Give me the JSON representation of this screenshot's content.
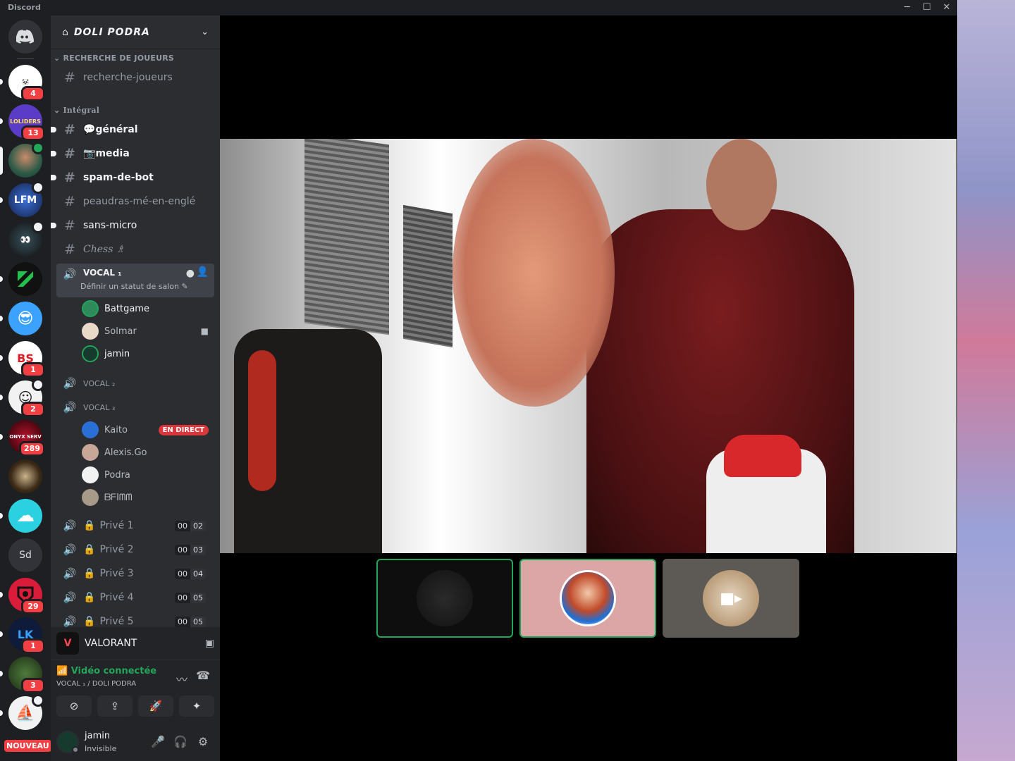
{
  "window": {
    "app_name": "Discord",
    "controls": [
      "minimize",
      "maximize",
      "close"
    ]
  },
  "servers": [
    {
      "name": "discord-home",
      "badge": ""
    },
    {
      "name": "WEGOPANDA",
      "badge": "4"
    },
    {
      "name": "LOLIDERS",
      "badge": "13"
    },
    {
      "name": "avatar-server",
      "badge": ""
    },
    {
      "name": "LFM",
      "badge": ""
    },
    {
      "name": "server-5",
      "badge": ""
    },
    {
      "name": "server-6",
      "badge": ""
    },
    {
      "name": "server-7",
      "badge": ""
    },
    {
      "name": "BS",
      "badge": "1"
    },
    {
      "name": "server-9",
      "badge": "2"
    },
    {
      "name": "ONYX SERV",
      "badge": "289"
    },
    {
      "name": "server-11",
      "badge": ""
    },
    {
      "name": "cloud-server",
      "badge": ""
    },
    {
      "name": "Sd",
      "badge": ""
    },
    {
      "name": "server-14",
      "badge": "29"
    },
    {
      "name": "LK COMMU",
      "badge": "1"
    },
    {
      "name": "server-16",
      "badge": "3"
    },
    {
      "name": "server-17",
      "badge": ""
    }
  ],
  "new_label": "NOUVEAU",
  "guild": {
    "name": "DOLI PODRA"
  },
  "categories": {
    "recherche": "RECHERCHE DE JOUEURS",
    "integral": "Intégral"
  },
  "channels": {
    "recherche_joueurs": "recherche-joueurs",
    "general": "général",
    "media": "media",
    "spam": "spam-de-bot",
    "peaudras": "peaudras-mé-en-englé",
    "sans_micro": "sans-micro",
    "chess": "Chess"
  },
  "voice": {
    "vocal1": {
      "name": "VOCAL ₁",
      "status": "Définir un statut de salon"
    },
    "vocal1_members": [
      "Battgame",
      "Solmar",
      "jamin"
    ],
    "vocal2": "VOCAL ₂",
    "vocal3": "VOCAL ₃",
    "vocal3_members": [
      "Kaito",
      "Alexis.Go",
      "Podra",
      "ᗷᖴIᗰᗰ"
    ],
    "live_badge": "EN DIRECT",
    "private": [
      {
        "name": "Privé 1",
        "a": "00",
        "b": "02"
      },
      {
        "name": "Privé 2",
        "a": "00",
        "b": "03"
      },
      {
        "name": "Privé 3",
        "a": "00",
        "b": "04"
      },
      {
        "name": "Privé 4",
        "a": "00",
        "b": "05"
      },
      {
        "name": "Privé 5",
        "a": "00",
        "b": "05"
      }
    ]
  },
  "activity": {
    "game": "VALORANT"
  },
  "voice_panel": {
    "status": "Vidéo connectée",
    "location": "VOCAL ₁ / DOLI PODRA"
  },
  "user": {
    "name": "jamin",
    "status": "Invisible"
  },
  "colors": {
    "accent_green": "#23a55a",
    "badge_red": "#f23f43",
    "sidebar": "#2b2d31",
    "rail": "#1e1f22"
  }
}
